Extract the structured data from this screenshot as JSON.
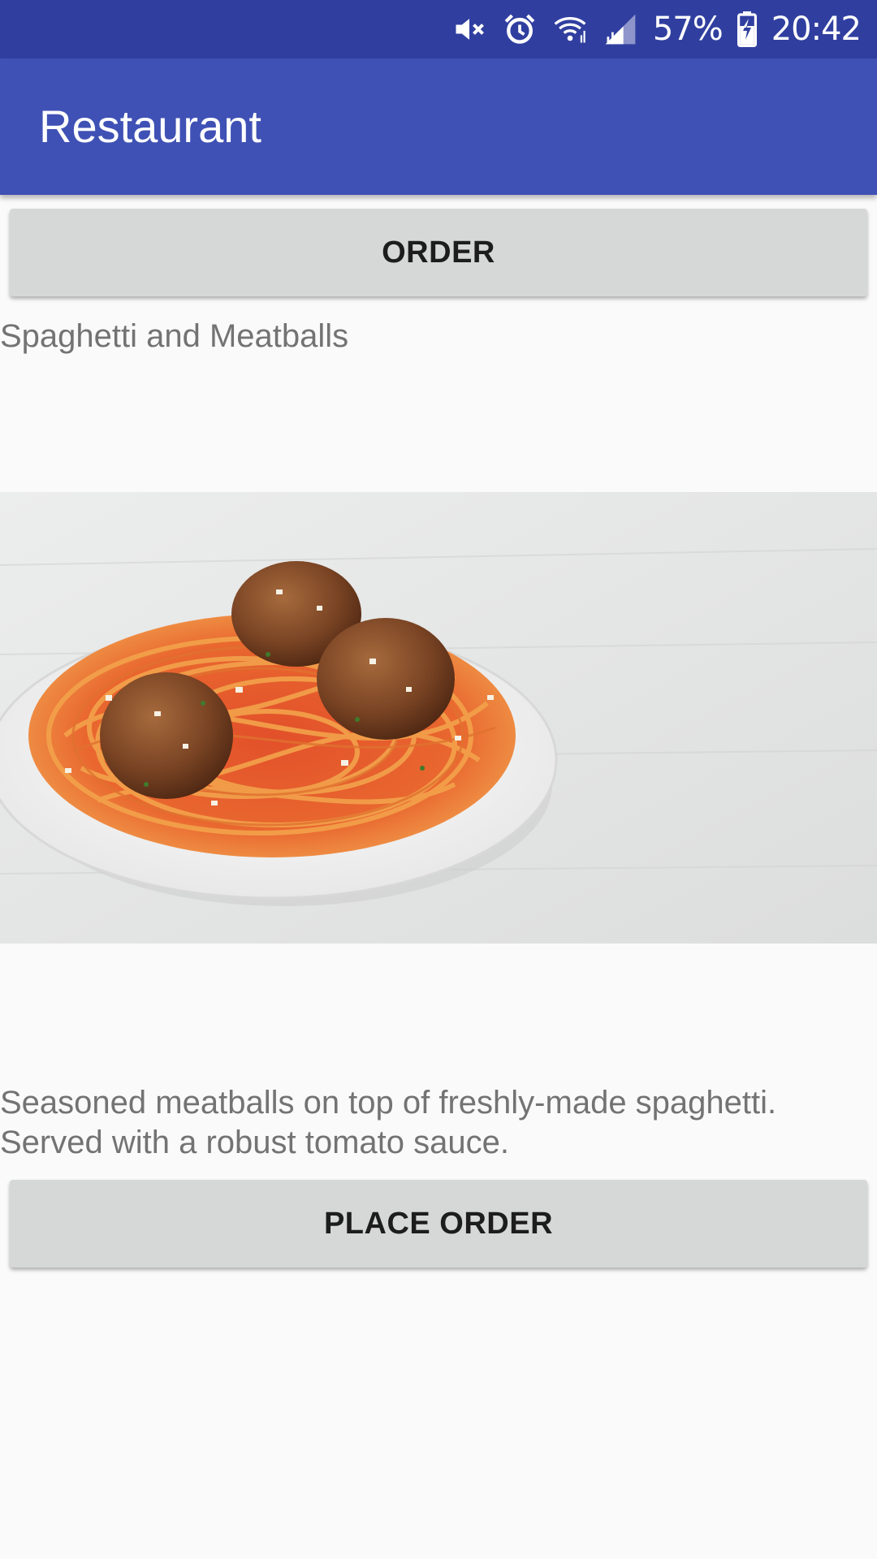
{
  "status_bar": {
    "icons": [
      "mute-icon",
      "alarm-icon",
      "wifi-icon",
      "signal-icon"
    ],
    "battery_percent": "57%",
    "battery_icon": "battery-charging-icon",
    "time": "20:42",
    "background": "#303f9f"
  },
  "app_bar": {
    "title": "Restaurant",
    "background": "#3f51b5"
  },
  "order_button": {
    "label": "ORDER"
  },
  "dish": {
    "name": "Spaghetti and Meatballs",
    "image": "spaghetti-meatballs-photo",
    "description": "Seasoned meatballs on top of freshly-made spaghetti. Served with a robust tomato sauce."
  },
  "place_order_button": {
    "label": "PLACE ORDER"
  }
}
